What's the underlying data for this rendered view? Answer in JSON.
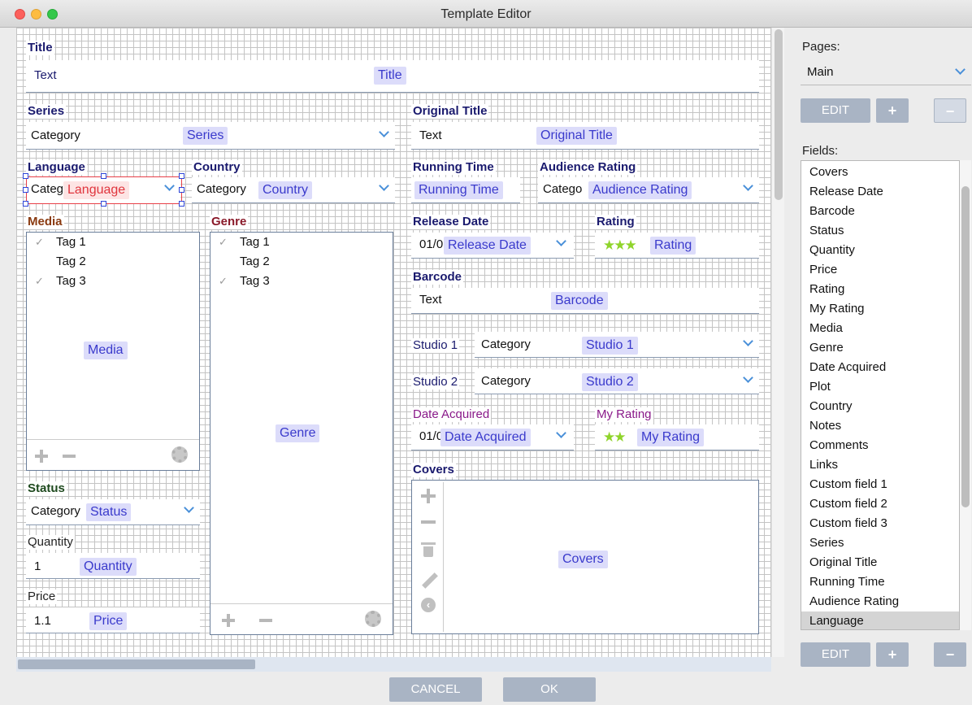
{
  "window": {
    "title": "Template Editor"
  },
  "editor": {
    "title_label": "Title",
    "title_value": "Text",
    "title_tag": "Title",
    "series_label": "Series",
    "series_value": "Category",
    "series_tag": "Series",
    "original_title_label": "Original Title",
    "original_title_value": "Text",
    "original_title_tag": "Original Title",
    "language_label": "Language",
    "language_value": "Categ",
    "language_tag": "Language",
    "country_label": "Country",
    "country_value": "Category",
    "country_tag": "Country",
    "running_time_label": "Running Time",
    "running_time_tag": "Running Time",
    "audience_rating_label": "Audience Rating",
    "audience_rating_value": "Catego",
    "audience_rating_tag": "Audience Rating",
    "media_label": "Media",
    "media_tags": [
      "Tag 1",
      "Tag 2",
      "Tag 3"
    ],
    "media_checked": [
      true,
      false,
      true
    ],
    "media_tag": "Media",
    "genre_label": "Genre",
    "genre_tags": [
      "Tag 1",
      "Tag 2",
      "Tag 3"
    ],
    "genre_checked": [
      true,
      false,
      true
    ],
    "genre_tag": "Genre",
    "release_date_label": "Release Date",
    "release_date_value": "01/0",
    "release_date_tag": "Release Date",
    "rating_label": "Rating",
    "rating_tag": "Rating",
    "rating_stars": 3,
    "barcode_label": "Barcode",
    "barcode_value": "Text",
    "barcode_tag": "Barcode",
    "studio1_label": "Studio 1",
    "studio1_value": "Category",
    "studio1_tag": "Studio 1",
    "studio2_label": "Studio 2",
    "studio2_value": "Category",
    "studio2_tag": "Studio 2",
    "date_acquired_label": "Date Acquired",
    "date_acquired_value": "01/0",
    "date_acquired_tag": "Date Acquired",
    "my_rating_label": "My Rating",
    "my_rating_tag": "My Rating",
    "my_rating_stars": 2,
    "covers_label": "Covers",
    "covers_tag": "Covers",
    "status_label": "Status",
    "status_value": "Category",
    "status_tag": "Status",
    "quantity_label": "Quantity",
    "quantity_value": "1",
    "quantity_tag": "Quantity",
    "price_label": "Price",
    "price_value": "1.1",
    "price_tag": "Price"
  },
  "right_panel": {
    "pages_label": "Pages:",
    "page_selected": "Main",
    "edit_label": "EDIT",
    "plus_label": "+",
    "minus_label": "−",
    "fields_label": "Fields:",
    "fields": [
      "Covers",
      "Release Date",
      "Barcode",
      "Status",
      "Quantity",
      "Price",
      "Rating",
      "My Rating",
      "Media",
      "Genre",
      "Date Acquired",
      "Plot",
      "Country",
      "Notes",
      "Comments",
      "Links",
      "Custom field 1",
      "Custom field 2",
      "Custom field 3",
      "Series",
      "Original Title",
      "Running Time",
      "Audience Rating",
      "Language"
    ],
    "selected_field": "Language"
  },
  "footer": {
    "cancel_label": "CANCEL",
    "ok_label": "OK"
  },
  "colors": {
    "accent": "#a9b4c4",
    "tag_bg": "#dcdcfa",
    "tag_text": "#3a3acc",
    "selection": "#e84048",
    "handle": "#2d45d8",
    "star": "#8fd42b"
  }
}
